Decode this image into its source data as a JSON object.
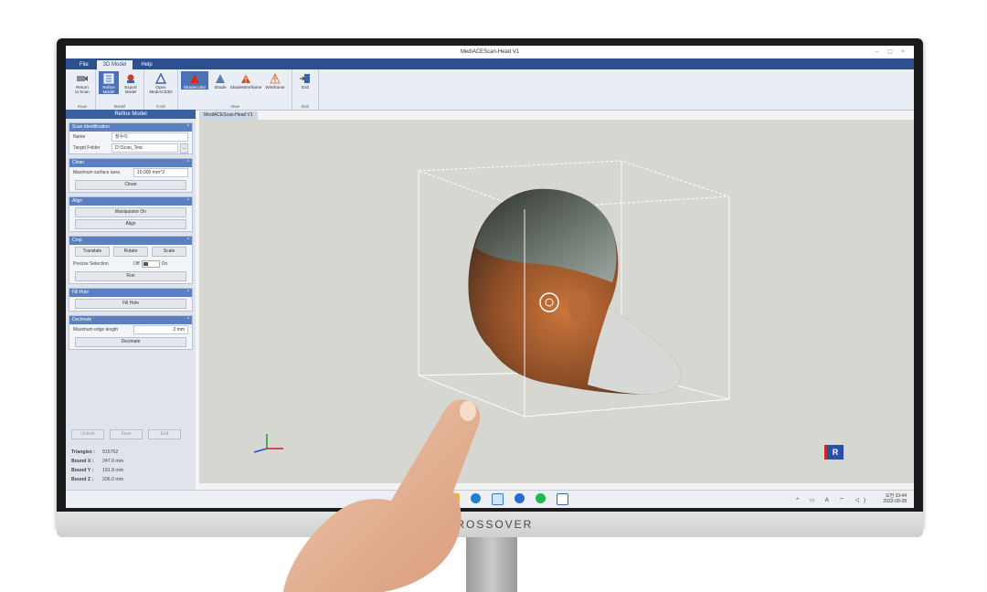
{
  "window": {
    "title": "MediACEScan-Head V1",
    "controls": "–  ▢  ×"
  },
  "menu": {
    "tabs": [
      "File",
      "3D Model",
      "Help"
    ]
  },
  "ribbon": {
    "groups": [
      {
        "label": "Scan",
        "buttons": [
          {
            "label1": "Return",
            "label2": "to Scan",
            "icon": "return-scan-icon"
          }
        ]
      },
      {
        "label": "Model",
        "buttons": [
          {
            "label1": "Refine",
            "label2": "Model",
            "icon": "refine-model-icon"
          },
          {
            "label1": "Export",
            "label2": "Model",
            "icon": "export-model-icon"
          }
        ]
      },
      {
        "label": "CAD",
        "buttons": [
          {
            "label1": "Open",
            "label2": "MediACE3D",
            "icon": "mediace3d-icon"
          }
        ]
      },
      {
        "label": "View",
        "buttons": [
          {
            "label1": "ShadeColor",
            "icon": "shade-color-icon"
          },
          {
            "label1": "Shade",
            "icon": "shade-icon"
          },
          {
            "label1": "ShadeWireframe",
            "icon": "shade-wireframe-icon"
          },
          {
            "label1": "Wireframe",
            "icon": "wireframe-icon"
          }
        ]
      },
      {
        "label": "Exit",
        "buttons": [
          {
            "label1": "Exit",
            "icon": "exit-icon"
          }
        ]
      }
    ]
  },
  "panel": {
    "title": "Refine Model",
    "scan_id": {
      "header": "Scan Identification",
      "name_label": "Name",
      "name_value": "장수이",
      "folder_label": "Target Folder",
      "folder_value": "D:\\Scan_Test",
      "browse": "..."
    },
    "clean": {
      "header": "Clean",
      "max_label": "Maximum surface area",
      "max_value": "10,000 mm^2",
      "button": "Clean"
    },
    "align": {
      "header": "Align",
      "manip_button": "Manipulator On",
      "align_button": "Align"
    },
    "crop": {
      "header": "Crop",
      "translate": "Translate",
      "rotate": "Rotate",
      "scale": "Scale",
      "precise_label": "Precise Selection",
      "off": "Off",
      "on": "On",
      "run": "Run"
    },
    "fill": {
      "header": "Fill Hole",
      "button": "Fill Hole"
    },
    "decimate": {
      "header": "Decimate",
      "edge_label": "Maximum edge length",
      "edge_value": "2 mm",
      "button": "Decimate"
    },
    "bottom_buttons": [
      "Unlock",
      "Save",
      "Exit"
    ],
    "stats": [
      {
        "label": "Triangles :",
        "value": "915702"
      },
      {
        "label": "Bound X :",
        "value": "247.0  mm"
      },
      {
        "label": "Bound Y :",
        "value": "191.8  mm"
      },
      {
        "label": "Bound Z :",
        "value": "206.0  mm"
      }
    ]
  },
  "viewport": {
    "tab": "MediACEScan-Head V1",
    "cube_label": "R"
  },
  "taskbar": {
    "time": "오전 10:44",
    "date": "2022-09-28",
    "tray": "^ ▭ A ⌔ ◁)"
  },
  "monitor": {
    "brand": "CROSSOVER"
  }
}
